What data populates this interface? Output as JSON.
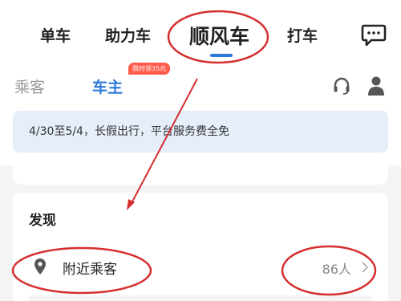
{
  "top_tabs": [
    "单车",
    "助力车",
    "顺风车",
    "打车"
  ],
  "active_top_tab": "顺风车",
  "sub_tabs": {
    "passenger": "乘客",
    "owner": "车主",
    "promo_badge": "限时领35元"
  },
  "notice": {
    "text": "4/30至5/4，长假出行，平台服务费全免"
  },
  "discover": {
    "title": "发现",
    "nearby_label": "附近乘客",
    "nearby_count": "86人"
  },
  "colors": {
    "accent": "#2d79d6",
    "annotation": "#d62e2e",
    "badge": "#ff5b4a"
  },
  "icons": [
    "chat-icon",
    "headset-icon",
    "person-icon",
    "location-pin-icon",
    "chevron-right-icon"
  ]
}
